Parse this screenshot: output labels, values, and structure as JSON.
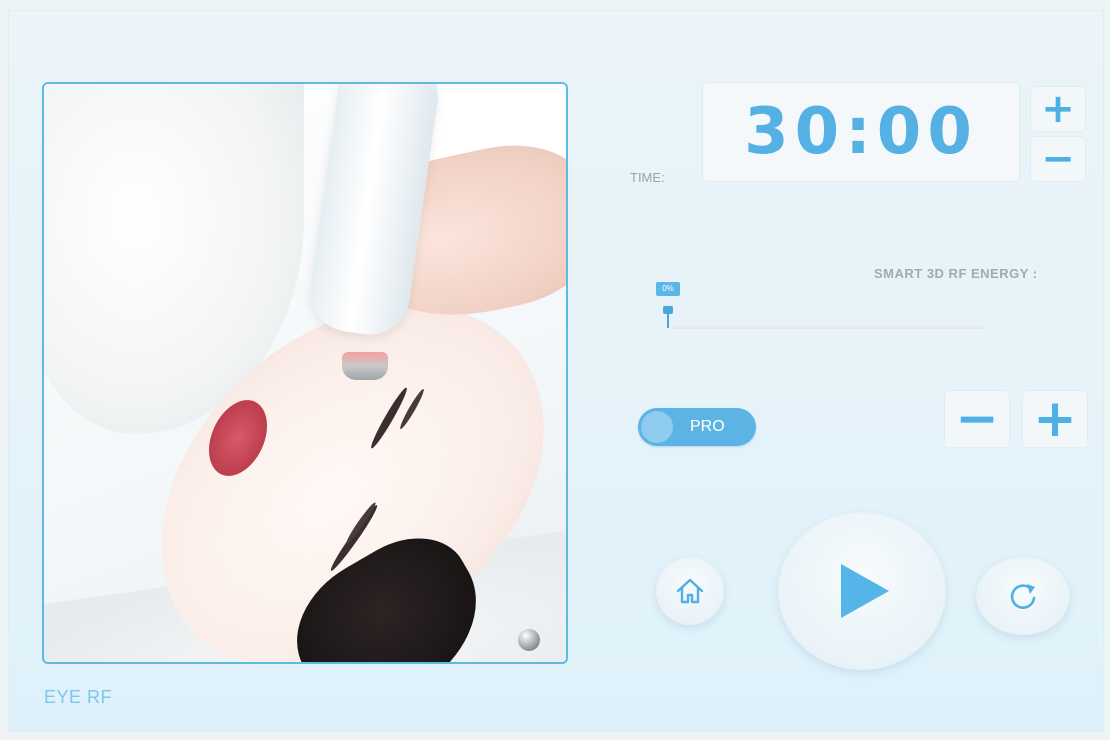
{
  "mode": {
    "label": "EYE RF"
  },
  "timer": {
    "label": "TIME:",
    "value": "30:00",
    "plus": "+",
    "minus": "−"
  },
  "energy": {
    "label": "SMART 3D RF ENERGY :",
    "percent_text": "0%",
    "level": 0,
    "minus": "−",
    "plus": "+"
  },
  "pro_toggle": {
    "label": "PRO",
    "state": "off"
  },
  "controls": {
    "home_icon": "home-icon",
    "play_icon": "play-icon",
    "reset_icon": "refresh-icon"
  },
  "colors": {
    "accent": "#5bb4e6",
    "background": "#e7f3f9"
  }
}
